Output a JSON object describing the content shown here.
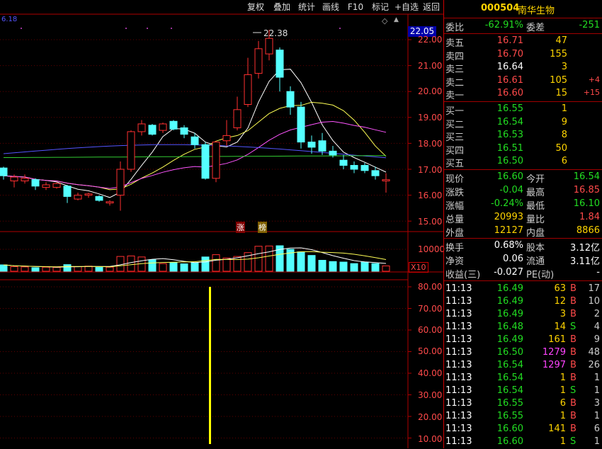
{
  "toolbar": {
    "buttons": [
      "复权",
      "叠加",
      "统计",
      "画线",
      "F10",
      "标记",
      "+自选",
      "返回"
    ]
  },
  "chart": {
    "ma_readout": "6.18",
    "current_price_tag": "22.05",
    "high_annotation": "22.38",
    "price_ticks": [
      "22.00",
      "21.00",
      "20.00",
      "19.00",
      "18.00",
      "17.00",
      "16.00",
      "15.00"
    ],
    "markers": [
      "涨",
      "榜"
    ],
    "volume_ticks": [
      "10000",
      "5000"
    ],
    "volume_unit": "X10",
    "indicator_ticks": [
      "80.00",
      "70.00",
      "60.00",
      "50.00",
      "40.00",
      "30.00",
      "20.00",
      "10.00"
    ],
    "colors": {
      "up": "#ff3030",
      "down": "#54ffff",
      "ma5": "#ffffff",
      "ma10": "#ffff55",
      "ma20": "#ff55ff",
      "ma60": "#5555ff",
      "ma120": "#33cc33"
    }
  },
  "chart_data": {
    "type": "candlestick",
    "ylim": [
      15,
      22.5
    ],
    "candles": [
      {
        "o": 17.05,
        "c": 16.75,
        "h": 17.1,
        "l": 16.6,
        "v": 250
      },
      {
        "o": 16.55,
        "c": 16.7,
        "h": 16.8,
        "l": 16.3,
        "v": 180
      },
      {
        "o": 16.55,
        "c": 16.65,
        "h": 16.8,
        "l": 16.45,
        "v": 170
      },
      {
        "o": 16.6,
        "c": 16.35,
        "h": 16.65,
        "l": 16.2,
        "v": 140
      },
      {
        "o": 16.3,
        "c": 16.4,
        "h": 16.5,
        "l": 16.2,
        "v": 160
      },
      {
        "o": 16.3,
        "c": 16.45,
        "h": 16.5,
        "l": 16.25,
        "v": 150
      },
      {
        "o": 16.35,
        "c": 15.95,
        "h": 16.4,
        "l": 15.7,
        "v": 260
      },
      {
        "o": 15.85,
        "c": 16.0,
        "h": 16.1,
        "l": 15.8,
        "v": 180
      },
      {
        "o": 16.0,
        "c": 16.05,
        "h": 16.1,
        "l": 15.9,
        "v": 200
      },
      {
        "o": 15.95,
        "c": 15.8,
        "h": 16.0,
        "l": 15.75,
        "v": 150
      },
      {
        "o": 15.7,
        "c": 15.75,
        "h": 15.8,
        "l": 15.6,
        "v": 160
      },
      {
        "o": 16.0,
        "c": 17.0,
        "h": 17.3,
        "l": 15.4,
        "v": 580
      },
      {
        "o": 17.0,
        "c": 18.45,
        "h": 18.5,
        "l": 16.9,
        "v": 600
      },
      {
        "o": 18.45,
        "c": 18.75,
        "h": 18.9,
        "l": 18.3,
        "v": 560
      },
      {
        "o": 18.7,
        "c": 18.35,
        "h": 18.75,
        "l": 18.3,
        "v": 450
      },
      {
        "o": 18.5,
        "c": 18.75,
        "h": 18.8,
        "l": 18.4,
        "v": 300
      },
      {
        "o": 18.85,
        "c": 18.55,
        "h": 18.9,
        "l": 18.5,
        "v": 340
      },
      {
        "o": 18.6,
        "c": 18.35,
        "h": 18.7,
        "l": 18.2,
        "v": 290
      },
      {
        "o": 18.25,
        "c": 17.95,
        "h": 18.4,
        "l": 17.8,
        "v": 330
      },
      {
        "o": 17.95,
        "c": 16.65,
        "h": 18.05,
        "l": 16.6,
        "v": 560
      },
      {
        "o": 16.65,
        "c": 18.05,
        "h": 18.1,
        "l": 16.5,
        "v": 650
      },
      {
        "o": 18.1,
        "c": 18.3,
        "h": 18.9,
        "l": 17.9,
        "v": 520
      },
      {
        "o": 18.6,
        "c": 19.3,
        "h": 19.8,
        "l": 18.5,
        "v": 580
      },
      {
        "o": 19.5,
        "c": 20.65,
        "h": 21.3,
        "l": 19.4,
        "v": 730
      },
      {
        "o": 20.7,
        "c": 21.65,
        "h": 21.95,
        "l": 20.5,
        "v": 980
      },
      {
        "o": 21.45,
        "c": 22.05,
        "h": 22.38,
        "l": 21.2,
        "v": 990
      },
      {
        "o": 21.6,
        "c": 20.55,
        "h": 21.7,
        "l": 20.0,
        "v": 1000
      },
      {
        "o": 20.0,
        "c": 19.4,
        "h": 20.2,
        "l": 19.1,
        "v": 860
      },
      {
        "o": 19.4,
        "c": 18.05,
        "h": 19.6,
        "l": 17.8,
        "v": 760
      },
      {
        "o": 18.05,
        "c": 17.85,
        "h": 18.3,
        "l": 17.6,
        "v": 620
      },
      {
        "o": 18.1,
        "c": 17.7,
        "h": 18.4,
        "l": 17.55,
        "v": 430
      },
      {
        "o": 17.7,
        "c": 17.55,
        "h": 17.9,
        "l": 17.45,
        "v": 380
      },
      {
        "o": 17.35,
        "c": 17.15,
        "h": 17.55,
        "l": 17.0,
        "v": 360
      },
      {
        "o": 17.15,
        "c": 17.0,
        "h": 17.3,
        "l": 16.85,
        "v": 300
      },
      {
        "o": 17.15,
        "c": 16.95,
        "h": 17.25,
        "l": 16.85,
        "v": 360
      },
      {
        "o": 16.95,
        "c": 16.75,
        "h": 17.1,
        "l": 16.6,
        "v": 300
      },
      {
        "o": 16.55,
        "c": 16.6,
        "h": 16.85,
        "l": 16.1,
        "v": 210
      }
    ],
    "indicator_value": 80
  },
  "quote": {
    "code": "000504",
    "name": "南华生物",
    "webi_label": "委比",
    "webi": "-62.91%",
    "weicha_label": "委差",
    "weicha": "-251",
    "asks": [
      {
        "label": "卖五",
        "price": "16.71",
        "vol": "47",
        "chg": ""
      },
      {
        "label": "卖四",
        "price": "16.70",
        "vol": "155",
        "chg": ""
      },
      {
        "label": "卖三",
        "price": "16.64",
        "vol": "3",
        "chg": ""
      },
      {
        "label": "卖二",
        "price": "16.61",
        "vol": "105",
        "chg": "+4"
      },
      {
        "label": "卖一",
        "price": "16.60",
        "vol": "15",
        "chg": "+15"
      }
    ],
    "bids": [
      {
        "label": "买一",
        "price": "16.55",
        "vol": "1"
      },
      {
        "label": "买二",
        "price": "16.54",
        "vol": "9"
      },
      {
        "label": "买三",
        "price": "16.53",
        "vol": "8"
      },
      {
        "label": "买四",
        "price": "16.51",
        "vol": "50"
      },
      {
        "label": "买五",
        "price": "16.50",
        "vol": "6"
      }
    ],
    "stats": [
      {
        "l1": "现价",
        "v1": "16.60",
        "l2": "今开",
        "v2": "16.54"
      },
      {
        "l1": "涨跌",
        "v1": "-0.04",
        "l2": "最高",
        "v2": "16.85"
      },
      {
        "l1": "涨幅",
        "v1": "-0.24%",
        "l2": "最低",
        "v2": "16.10"
      },
      {
        "l1": "总量",
        "v1": "20993",
        "l2": "量比",
        "v2": "1.84"
      },
      {
        "l1": "外盘",
        "v1": "12127",
        "l2": "内盘",
        "v2": "8866"
      }
    ],
    "finance": [
      {
        "l1": "换手",
        "v1": "0.68%",
        "l2": "股本",
        "v2": "3.12亿"
      },
      {
        "l1": "净资",
        "v1": "0.06",
        "l2": "流通",
        "v2": "3.11亿"
      },
      {
        "l1": "收益(三)",
        "v1": "-0.027",
        "l2": "PE(动)",
        "v2": "-"
      }
    ],
    "ticks": [
      {
        "t": "11:13",
        "p": "16.49",
        "v": "63",
        "s": "B",
        "n": "17"
      },
      {
        "t": "11:13",
        "p": "16.49",
        "v": "12",
        "s": "B",
        "n": "10"
      },
      {
        "t": "11:13",
        "p": "16.49",
        "v": "3",
        "s": "B",
        "n": "2"
      },
      {
        "t": "11:13",
        "p": "16.48",
        "v": "14",
        "s": "S",
        "n": "4"
      },
      {
        "t": "11:13",
        "p": "16.49",
        "v": "161",
        "s": "B",
        "n": "9"
      },
      {
        "t": "11:13",
        "p": "16.50",
        "v": "1279",
        "s": "B",
        "n": "48"
      },
      {
        "t": "11:13",
        "p": "16.54",
        "v": "1297",
        "s": "B",
        "n": "26"
      },
      {
        "t": "11:13",
        "p": "16.54",
        "v": "1",
        "s": "B",
        "n": "1"
      },
      {
        "t": "11:13",
        "p": "16.54",
        "v": "1",
        "s": "S",
        "n": "1"
      },
      {
        "t": "11:13",
        "p": "16.55",
        "v": "6",
        "s": "B",
        "n": "3"
      },
      {
        "t": "11:13",
        "p": "16.55",
        "v": "1",
        "s": "B",
        "n": "1"
      },
      {
        "t": "11:13",
        "p": "16.60",
        "v": "141",
        "s": "B",
        "n": "6"
      },
      {
        "t": "11:13",
        "p": "16.60",
        "v": "1",
        "s": "S",
        "n": "1"
      }
    ]
  }
}
